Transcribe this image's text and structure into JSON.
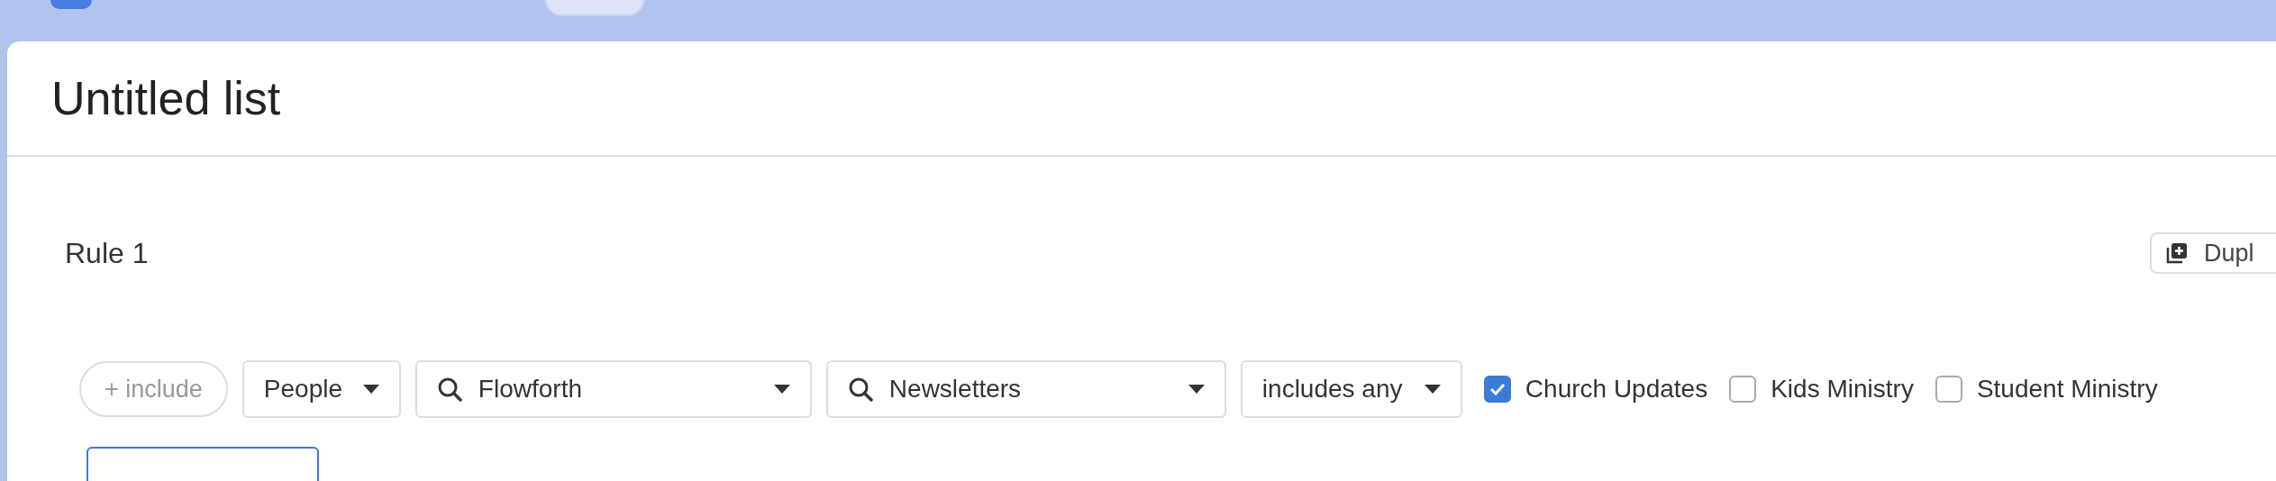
{
  "list": {
    "title": "Untitled list"
  },
  "rule": {
    "title": "Rule 1",
    "duplicate_button": "Dupl",
    "include": "+ include",
    "filters": [
      {
        "kind": "select",
        "value": "People"
      },
      {
        "kind": "search",
        "value": "Flowforth"
      },
      {
        "kind": "search",
        "value": "Newsletters"
      },
      {
        "kind": "select",
        "value": "includes any"
      }
    ],
    "options": [
      {
        "label": "Church Updates",
        "checked": true
      },
      {
        "label": "Kids Ministry",
        "checked": false
      },
      {
        "label": "Student Ministry",
        "checked": false
      }
    ]
  }
}
